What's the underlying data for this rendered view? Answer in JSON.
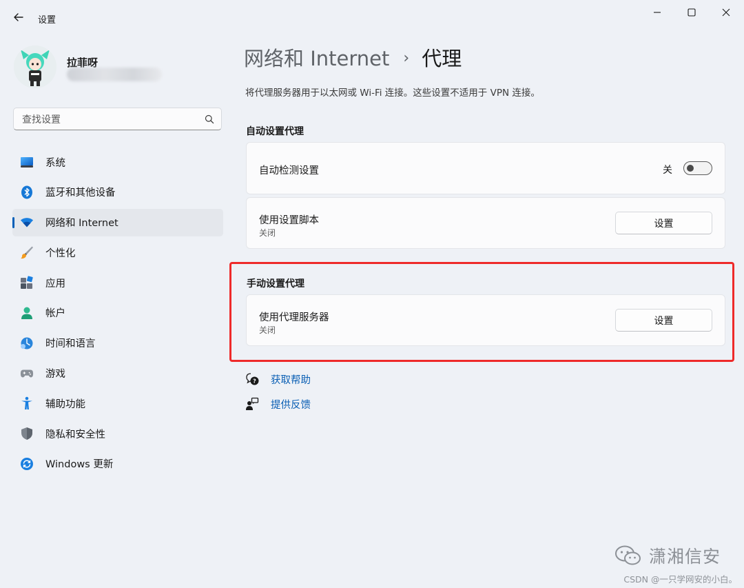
{
  "window": {
    "title": "设置",
    "controls": [
      "minimize-icon",
      "maximize-icon",
      "close-icon"
    ]
  },
  "profile": {
    "name": "拉菲呀"
  },
  "search": {
    "placeholder": "查找设置",
    "icon": "search-icon"
  },
  "sidebar": {
    "items": [
      {
        "label": "系统",
        "icon": "system-icon"
      },
      {
        "label": "蓝牙和其他设备",
        "icon": "bluetooth-icon"
      },
      {
        "label": "网络和 Internet",
        "icon": "wifi-icon",
        "active": true
      },
      {
        "label": "个性化",
        "icon": "brush-icon"
      },
      {
        "label": "应用",
        "icon": "apps-icon"
      },
      {
        "label": "帐户",
        "icon": "account-icon"
      },
      {
        "label": "时间和语言",
        "icon": "time-language-icon"
      },
      {
        "label": "游戏",
        "icon": "gamepad-icon"
      },
      {
        "label": "辅助功能",
        "icon": "accessibility-icon"
      },
      {
        "label": "隐私和安全性",
        "icon": "shield-icon"
      },
      {
        "label": "Windows 更新",
        "icon": "update-icon"
      }
    ]
  },
  "breadcrumb": {
    "parent": "网络和 Internet",
    "separator": "›",
    "current": "代理"
  },
  "description": "将代理服务器用于以太网或 Wi-Fi 连接。这些设置不适用于 VPN 连接。",
  "auto_section": {
    "heading": "自动设置代理",
    "detect": {
      "title": "自动检测设置",
      "state_label": "关",
      "on": false
    },
    "script": {
      "title": "使用设置脚本",
      "status": "关闭",
      "button": "设置"
    }
  },
  "manual_section": {
    "heading": "手动设置代理",
    "proxy": {
      "title": "使用代理服务器",
      "status": "关闭",
      "button": "设置"
    }
  },
  "links": {
    "help": "获取帮助",
    "feedback": "提供反馈"
  },
  "watermark": {
    "brand": "潇湘信安",
    "credit": "CSDN @一只学网安的小白。"
  },
  "colors": {
    "accent": "#005fb8",
    "link": "#0a5fb4",
    "highlight_box": "#ee2a2a",
    "background": "#eef1f6"
  }
}
